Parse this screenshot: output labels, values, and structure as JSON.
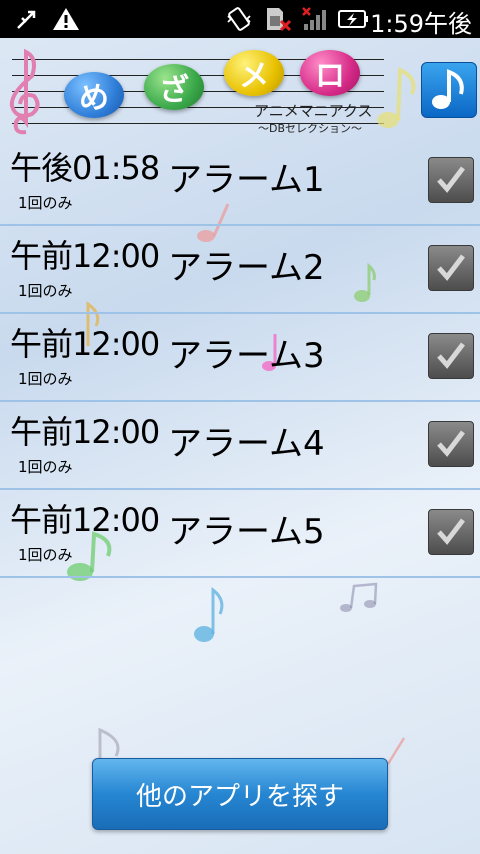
{
  "status_bar": {
    "time": "1:59午後",
    "icons": [
      "usb-debug-icon",
      "warning-icon",
      "vibrate-icon",
      "sim-missing-icon",
      "no-signal-icon",
      "battery-charging-icon"
    ]
  },
  "header": {
    "logo_chars": [
      "め",
      "ざ",
      "メ",
      "ロ"
    ],
    "logo_colors": [
      "#2f7ed8",
      "#3aa84a",
      "#e8c100",
      "#d62b88"
    ],
    "subtitle": "アニメマニアクス",
    "subtitle_sub": "〜DBセレクション〜",
    "music_button_icon": "music-note-icon"
  },
  "alarms": [
    {
      "time": "午後01:58",
      "repeat": "1回のみ",
      "name": "アラーム1",
      "checked": true
    },
    {
      "time": "午前12:00",
      "repeat": "1回のみ",
      "name": "アラーム2",
      "checked": true
    },
    {
      "time": "午前12:00",
      "repeat": "1回のみ",
      "name": "アラーム3",
      "checked": true
    },
    {
      "time": "午前12:00",
      "repeat": "1回のみ",
      "name": "アラーム4",
      "checked": true
    },
    {
      "time": "午前12:00",
      "repeat": "1回のみ",
      "name": "アラーム5",
      "checked": true
    }
  ],
  "footer": {
    "find_apps_label": "他のアプリを探す"
  }
}
